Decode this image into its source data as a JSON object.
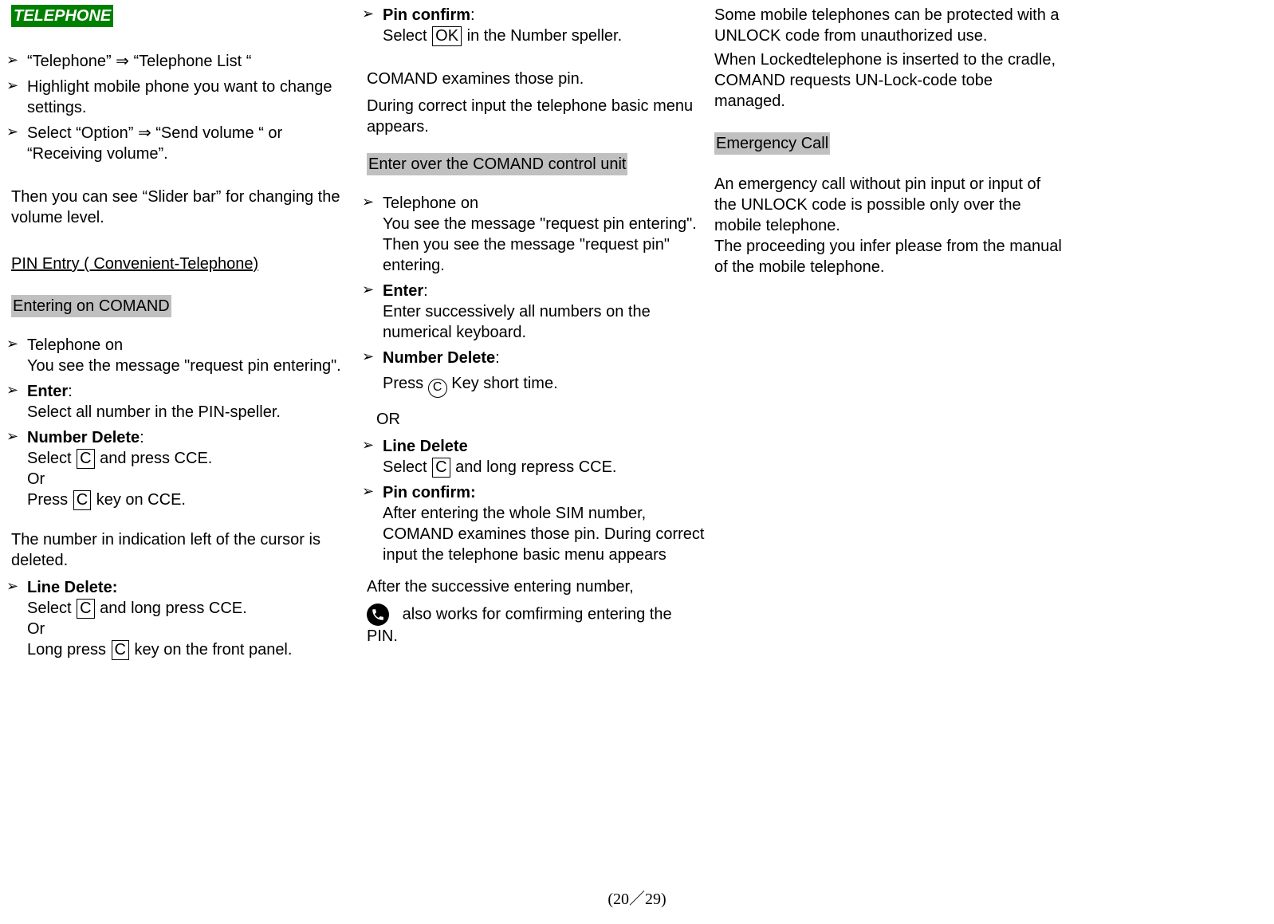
{
  "title": "TELEPHONE",
  "col1": {
    "b1": "“Telephone”  ⇒  “Telephone List “",
    "b2": "Highlight mobile phone you want to change settings.",
    "b3a": "Select “Option”  ⇒  “Send volume “  or",
    "b3b": "“Receiving volume”.",
    "p1": "Then you can see “Slider bar” for changing the volume level.",
    "h_pin": "PIN Entry ( Convenient-Telephone)",
    "h_entering": "Entering on COMAND",
    "b4a": "Telephone on",
    "b4b": "You see the message \"request pin entering\".",
    "b5_label": "Enter",
    "b5_body": "Select all number in the PIN-speller.",
    "b6_label": "Number Delete",
    "b6_body1a": "Select ",
    "b6_body1b": " and press CCE.",
    "b6_or": "Or",
    "b6_body2a": "Press ",
    "b6_body2b": "key on CCE.",
    "p2": "The number in indication left of the cursor is deleted.",
    "b7_label": "Line Delete:",
    "b7_body1a": "Select ",
    "b7_body1b": " and long press CCE.",
    "b7_or": "Or",
    "b7_body2a": "Long press ",
    "b7_body2b": " key on the front panel.",
    "boxC": "C"
  },
  "col2": {
    "b1_label": "Pin confirm",
    "b1_body_a": "Select ",
    "b1_body_b": " in the Number speller.",
    "boxOK": "OK",
    "p1": "COMAND examines those pin.",
    "p2": "During correct input the telephone basic menu appears.",
    "h_enter_over": "Enter over the COMAND control unit",
    "b2a": "Telephone on",
    "b2b": "You see the message \"request pin entering\".",
    "b2c": "Then you see the message \"request pin\" entering.",
    "b3_label": "Enter",
    "b3_body": "Enter successively all numbers on the numerical keyboard.",
    "b4_label": "Number Delete",
    "b4_body_a": "Press  ",
    "b4_body_b": "  Key short time.",
    "circleC": "C",
    "or_small": "OR",
    "b5_label": "Line Delete",
    "b5_body_a": "Select ",
    "b5_body_b": " and long repress CCE.",
    "boxC": "C",
    "b6_label": "Pin confirm:",
    "b6_body": "After entering the whole SIM number, COMAND examines those pin. During correct input the telephone basic menu appears",
    "p3": "After the successive entering number,",
    "p4": " also works for comfirming entering the PIN."
  },
  "col3": {
    "p1": "Some mobile telephones can be protected with a UNLOCK code from unauthorized use.",
    "p2": "When Lockedtelephone is inserted to the cradle, COMAND requests UN-Lock-code tobe managed.",
    "h_emergency": "Emergency Call",
    "p3": "An emergency call without pin input or input of the UNLOCK code is possible only over the mobile telephone.",
    "p4": "The proceeding you infer please from the manual of the mobile telephone."
  },
  "footer": "(20／29)"
}
